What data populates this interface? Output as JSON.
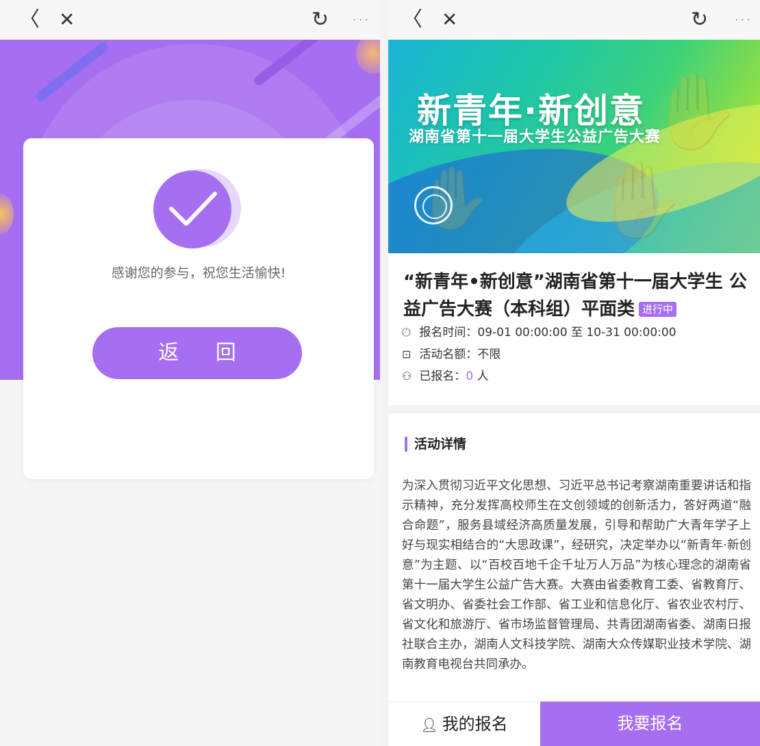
{
  "left": {
    "nav": {
      "back_icon": "〈",
      "close_icon": "✕",
      "refresh_icon": "↻",
      "more_icon": "···"
    },
    "thanks_message": "感谢您的参与，祝您生活愉快!",
    "return_label": "返 回",
    "accent": "#a66ef0"
  },
  "right": {
    "nav": {
      "back_icon": "〈",
      "close_icon": "✕",
      "refresh_icon": "↻",
      "more_icon": "···"
    },
    "banner": {
      "title": "新青年·新创意",
      "subtitle": "湖南省第十一届大学生公益广告大赛"
    },
    "event": {
      "title": "“新青年•新创意”湖南省第十一届大学生 公益广告大赛（本科组）平面类",
      "status_badge": "进行中",
      "signup_time_label": "报名时间：",
      "signup_time_value": "09-01 00:00:00 至 10-31 00:00:00",
      "quota_label": "活动名额：",
      "quota_value": "不限",
      "registered_label": "已报名：",
      "registered_count": "0",
      "registered_unit": " 人"
    },
    "details": {
      "heading": "活动详情",
      "body": "为深入贯彻习近平文化思想、习近平总书记考察湖南重要讲话和指示精神，充分发挥高校师生在文创领域的创新活力，答好两道“融合命题”，服务县域经济高质量发展，引导和帮助广大青年学子上好与现实相结合的“大思政课”，经研究，决定举办以“新青年·新创意”为主题、以“百校百地千企千址万人万品”为核心理念的湖南省第十一届大学生公益广告大赛。大赛由省委教育工委、省教育厅、省文明办、省委社会工作部、省工业和信息化厅、省农业农村厅、省文化和旅游厅、省市场监督管理局、共青团湖南省委、湖南日报社联合主办，湖南人文科技学院、湖南大众传媒职业技术学院、湖南教育电视台共同承办。"
    },
    "bottom": {
      "my_signup_label": "我的报名",
      "signup_button_label": "我要报名"
    }
  }
}
